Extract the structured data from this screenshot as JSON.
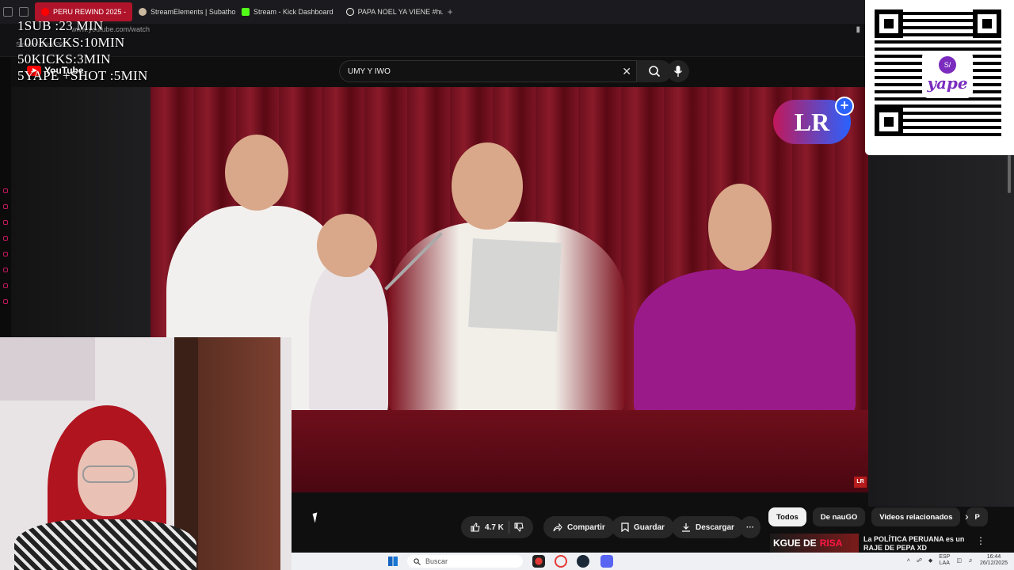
{
  "browser": {
    "tabs": [
      {
        "label": "PERU REWIND 2025 -",
        "active": true
      },
      {
        "label": "StreamElements | Subathon",
        "active": false
      },
      {
        "label": "Stream - Kick Dashboard",
        "active": false
      },
      {
        "label": "PAPA NOEL YA VIENE #humor",
        "active": false
      }
    ],
    "new_tab": "+",
    "url": "www.youtube.com/watch",
    "bookmark": "Stream - Kick 2025 -"
  },
  "overlay": {
    "lines": [
      "1SUB :23 MIN",
      "100KICKS:10MIN",
      "50KICKS:3MIN",
      "5YAPE +SHOT :5MIN"
    ]
  },
  "youtube": {
    "logo": "YouTube",
    "search_value": "UMY Y IWO",
    "clear": "✕"
  },
  "video": {
    "logo": "LR",
    "corner_logo": "LR"
  },
  "qr": {
    "brand": "yape",
    "badge": "S/"
  },
  "actions": {
    "likes": "4.7 K",
    "share": "Compartir",
    "save": "Guardar",
    "download": "Descargar",
    "more": "···"
  },
  "chips": {
    "items": [
      "Todos",
      "De nauGO",
      "Videos relacionados",
      "P"
    ],
    "active": "Todos"
  },
  "related": {
    "thumb_text_1": "KGUE DE",
    "thumb_text_2": "RISA",
    "title": "La POLÍTICA PERUANA es un RAJE DE PEPA XD"
  },
  "taskbar": {
    "search_placeholder": "Buscar",
    "lang_1": "ESP",
    "lang_2": "LAA",
    "time": "16:44",
    "date": "26/12/2025"
  },
  "colors": {
    "accent_red": "#ff0000",
    "yape_purple": "#7b2cbf",
    "active_tab": "#b0142a"
  }
}
